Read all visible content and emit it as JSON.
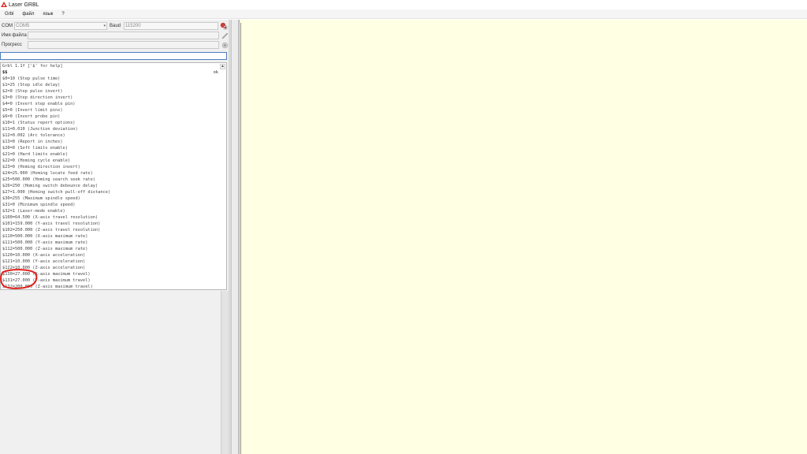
{
  "window": {
    "title": "Laser GRBL"
  },
  "menu": [
    "Grbl",
    "файл",
    "язык",
    "?"
  ],
  "connection": {
    "com_label": "COM",
    "com_value": "COM5",
    "baud_label": "Baud",
    "baud_value": "115200"
  },
  "file": {
    "label": "Имя файла"
  },
  "progress": {
    "label": "Прогресс"
  },
  "console": {
    "lines": [
      "Grbl 1.1f ['$' for help]",
      "$$",
      "$0=10 (Step pulse time)",
      "$1=25 (Step idle delay)",
      "$2=0 (Step pulse invert)",
      "$3=0 (Step direction invert)",
      "$4=0 (Invert step enable pin)",
      "$5=0 (Invert limit pins)",
      "$6=0 (Invert probe pin)",
      "$10=1 (Status report options)",
      "$11=0.010 (Junction deviation)",
      "$12=0.002 (Arc tolerance)",
      "$13=0 (Report in inches)",
      "$20=0 (Soft limits enable)",
      "$21=0 (Hard limits enable)",
      "$22=0 (Homing cycle enable)",
      "$23=0 (Homing direction invert)",
      "$24=25.000 (Homing locate feed rate)",
      "$25=500.000 (Homing search seek rate)",
      "$26=250 (Homing switch debounce delay)",
      "$27=1.000 (Homing switch pull-off distance)",
      "$30=255 (Maximum spindle speed)",
      "$31=0 (Minimum spindle speed)",
      "$32=1 (Laser-mode enable)",
      "$100=64.500 (X-axis travel resolution)",
      "$101=159.000 (Y-axis travel resolution)",
      "$102=250.000 (Z-axis travel resolution)",
      "$110=500.000 (X-axis maximum rate)",
      "$111=500.000 (Y-axis maximum rate)",
      "$112=500.000 (Z-axis maximum rate)",
      "$120=10.000 (X-axis acceleration)",
      "$121=10.000 (Y-axis acceleration)",
      "$122=10.000 (Z-axis acceleration)",
      "$130=27.000 (X-axis maximum travel)",
      "$131=27.000 (Y-axis maximum travel)",
      "$132=200.000 (Z-axis maximum travel)"
    ],
    "ok": "ok"
  },
  "colors": {
    "canvas": "#ffffe3",
    "annotation": "#e0201a",
    "input_border": "#4a7fc1"
  },
  "icons": {
    "app": "laser-icon",
    "connect": "connect-plug-icon",
    "open_file": "pencil-icon",
    "run": "run-icon"
  }
}
